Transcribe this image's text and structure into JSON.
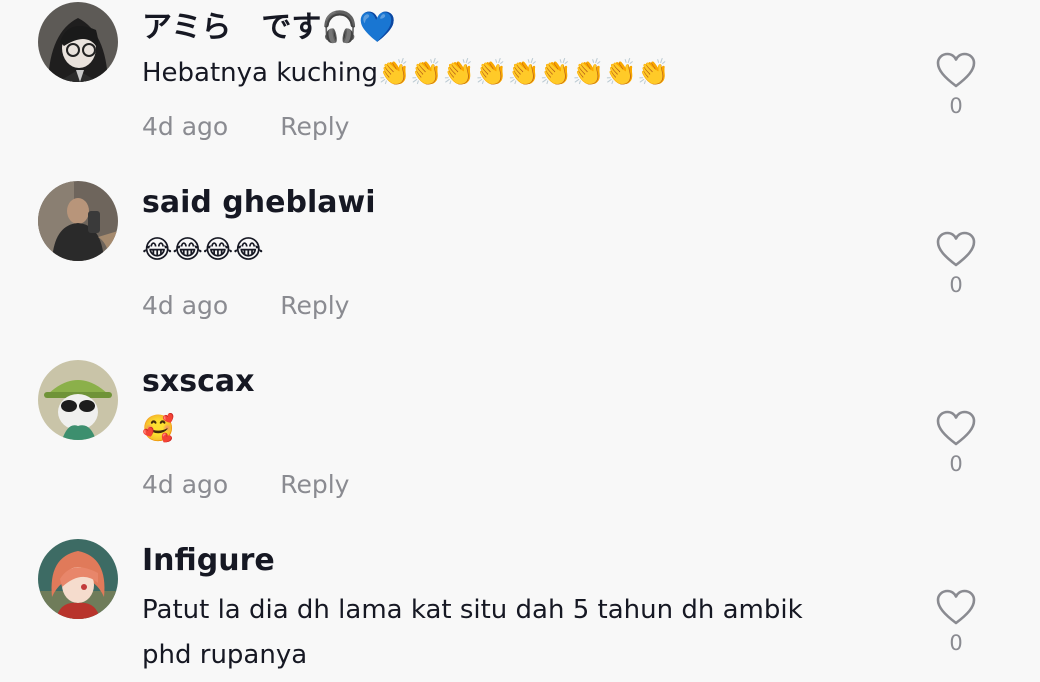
{
  "comments": [
    {
      "username": "アミら　です🎧💙",
      "text": "Hebatnya kuching👏👏👏👏👏👏👏👏👏",
      "time": "4d ago",
      "reply_label": "Reply",
      "likes": "0",
      "avatar_icon": "anime-girl-glasses-avatar"
    },
    {
      "username": "said gheblawi",
      "text": "😂😂😂😂",
      "time": "4d ago",
      "reply_label": "Reply",
      "likes": "0",
      "avatar_icon": "mirror-selfie-avatar"
    },
    {
      "username": "sxscax",
      "text": "🥰",
      "time": "4d ago",
      "reply_label": "Reply",
      "likes": "0",
      "avatar_icon": "green-hat-sunglasses-avatar"
    },
    {
      "username": "Infigure",
      "text_lines": [
        "Patut la dia dh lama kat situ dah 5 tahun dh ambik",
        "phd rupanya"
      ],
      "likes": "0",
      "avatar_icon": "red-hair-anime-avatar"
    }
  ],
  "colors": {
    "background": "#f8f8f8",
    "primary_text": "#161823",
    "secondary_text": "#8a8b91"
  }
}
